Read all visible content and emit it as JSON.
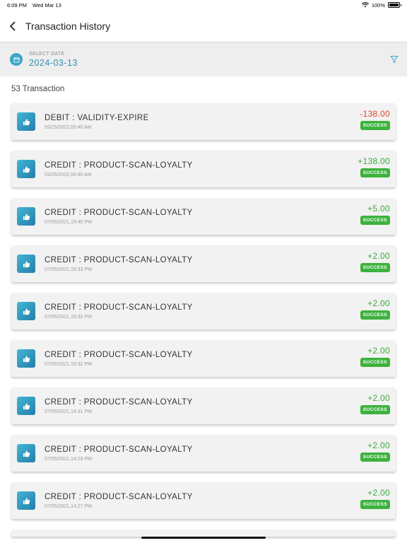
{
  "status_bar": {
    "time": "6:09 PM",
    "date": "Wed Mar 13",
    "battery": "100%"
  },
  "header": {
    "title": "Transaction History"
  },
  "date_filter": {
    "label": "SELECT DATE",
    "value": "2024-03-13"
  },
  "summary": {
    "count_text": "53 Transaction"
  },
  "transactions": [
    {
      "title": "DEBIT : VALIDITY-EXPIRE",
      "date": "03/25/2022,00:40 AM",
      "amount": "-138.00",
      "sign": "neg",
      "status": "SUCCESS"
    },
    {
      "title": "CREDIT : PRODUCT-SCAN-LOYALTY",
      "date": "03/25/2022,00:40 AM",
      "amount": "+138.00",
      "sign": "pos",
      "status": "SUCCESS"
    },
    {
      "title": "CREDIT : PRODUCT-SCAN-LOYALTY",
      "date": "07/05/2021,19:40 PM",
      "amount": "+5.00",
      "sign": "pos",
      "status": "SUCCESS"
    },
    {
      "title": "CREDIT : PRODUCT-SCAN-LOYALTY",
      "date": "07/05/2021,19:33 PM",
      "amount": "+2.00",
      "sign": "pos",
      "status": "SUCCESS"
    },
    {
      "title": "CREDIT : PRODUCT-SCAN-LOYALTY",
      "date": "07/05/2021,19:32 PM",
      "amount": "+2.00",
      "sign": "pos",
      "status": "SUCCESS"
    },
    {
      "title": "CREDIT : PRODUCT-SCAN-LOYALTY",
      "date": "07/05/2021,19:32 PM",
      "amount": "+2.00",
      "sign": "pos",
      "status": "SUCCESS"
    },
    {
      "title": "CREDIT : PRODUCT-SCAN-LOYALTY",
      "date": "07/05/2021,14:31 PM",
      "amount": "+2.00",
      "sign": "pos",
      "status": "SUCCESS"
    },
    {
      "title": "CREDIT : PRODUCT-SCAN-LOYALTY",
      "date": "07/05/2021,14:29 PM",
      "amount": "+2.00",
      "sign": "pos",
      "status": "SUCCESS"
    },
    {
      "title": "CREDIT : PRODUCT-SCAN-LOYALTY",
      "date": "07/05/2021,14:27 PM",
      "amount": "+2.00",
      "sign": "pos",
      "status": "SUCCESS"
    }
  ],
  "colors": {
    "accent": "#2e8fb5",
    "success": "#3db23d",
    "debit": "#e0452b",
    "credit": "#3daa3a"
  },
  "icons": {
    "back": "chevron-left-icon",
    "calendar": "calendar-icon",
    "filter": "filter-icon",
    "transaction": "thumbs-up-icon"
  }
}
